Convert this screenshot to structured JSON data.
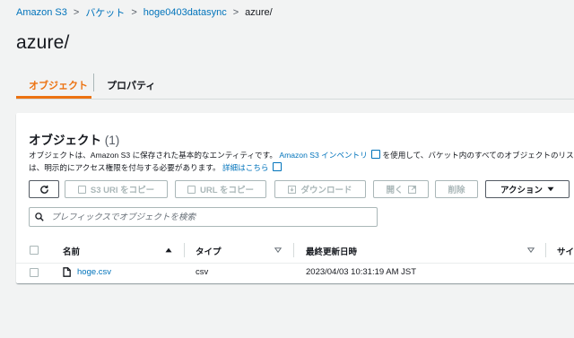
{
  "breadcrumb": {
    "items": [
      "Amazon S3",
      "バケット",
      "hoge0403datasync"
    ],
    "current": "azure/"
  },
  "page_title": "azure/",
  "tabs": [
    {
      "label": "オブジェクト",
      "active": true
    },
    {
      "label": "プロパティ",
      "active": false
    }
  ],
  "panel": {
    "title": "オブジェクト",
    "count": "(1)",
    "desc_part1": "オブジェクトは、Amazon S3 に保存された基本的なエンティティです。",
    "desc_link1": "Amazon S3 インベントリ",
    "desc_part2": "を使用して、バケット内のすべてのオブジェクトのリストを取",
    "desc_part3": "は、明示的にアクセス権限を付与する必要があります。",
    "desc_link2": "詳細はこちら"
  },
  "toolbar": {
    "copy_s3_uri": "S3 URI をコピー",
    "copy_url": "URL をコピー",
    "download": "ダウンロード",
    "open": "開く",
    "delete": "削除",
    "actions": "アクション"
  },
  "search": {
    "placeholder": "プレフィックスでオブジェクトを検索",
    "value": ""
  },
  "table": {
    "columns": [
      "名前",
      "タイプ",
      "最終更新日時",
      "サイ"
    ],
    "rows": [
      {
        "name": "hoge.csv",
        "type": "csv",
        "modified": "2023/04/03 10:31:19 AM JST"
      }
    ]
  },
  "colors": {
    "accent": "#ec7211",
    "link": "#0073bb",
    "text": "#16191f"
  },
  "icons": [
    "chevron-right-icon",
    "refresh-icon",
    "copy-icon",
    "download-icon",
    "external-link-icon",
    "caret-down-icon",
    "search-icon",
    "sort-up-icon",
    "sort-icon",
    "file-icon"
  ]
}
